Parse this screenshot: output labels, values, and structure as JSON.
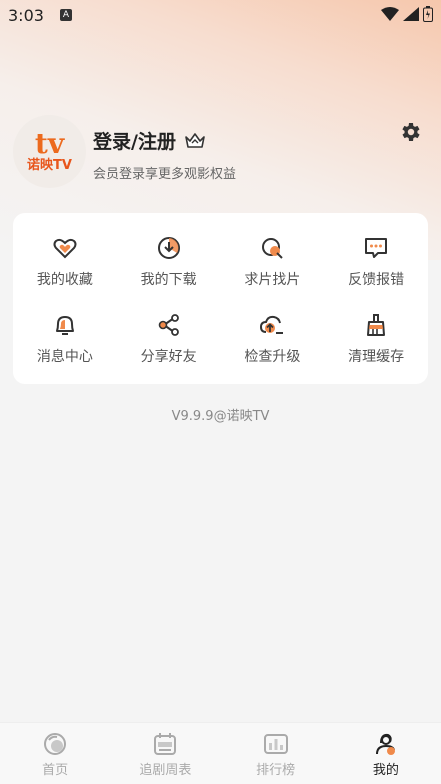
{
  "status_bar": {
    "time": "3:03",
    "notification_letter": "A"
  },
  "profile": {
    "logo_mark": "tv",
    "logo_text": "诺映TV",
    "login_title": "登录/注册",
    "subtitle": "会员登录享更多观影权益"
  },
  "menu": [
    {
      "label": "我的收藏",
      "icon": "heart-icon"
    },
    {
      "label": "我的下载",
      "icon": "download-icon"
    },
    {
      "label": "求片找片",
      "icon": "search-film-icon"
    },
    {
      "label": "反馈报错",
      "icon": "feedback-icon"
    },
    {
      "label": "消息中心",
      "icon": "bell-icon"
    },
    {
      "label": "分享好友",
      "icon": "share-icon"
    },
    {
      "label": "检查升级",
      "icon": "upgrade-icon"
    },
    {
      "label": "清理缓存",
      "icon": "clean-icon"
    }
  ],
  "version": "V9.9.9@诺映TV",
  "bottom_nav": [
    {
      "label": "首页",
      "icon": "home-icon",
      "active": false
    },
    {
      "label": "追剧周表",
      "icon": "calendar-icon",
      "active": false
    },
    {
      "label": "排行榜",
      "icon": "ranking-icon",
      "active": false
    },
    {
      "label": "我的",
      "icon": "profile-icon",
      "active": true
    }
  ],
  "colors": {
    "accent": "#ec6a1e",
    "icon_dark": "#333333",
    "icon_orange": "#f08a4b"
  }
}
